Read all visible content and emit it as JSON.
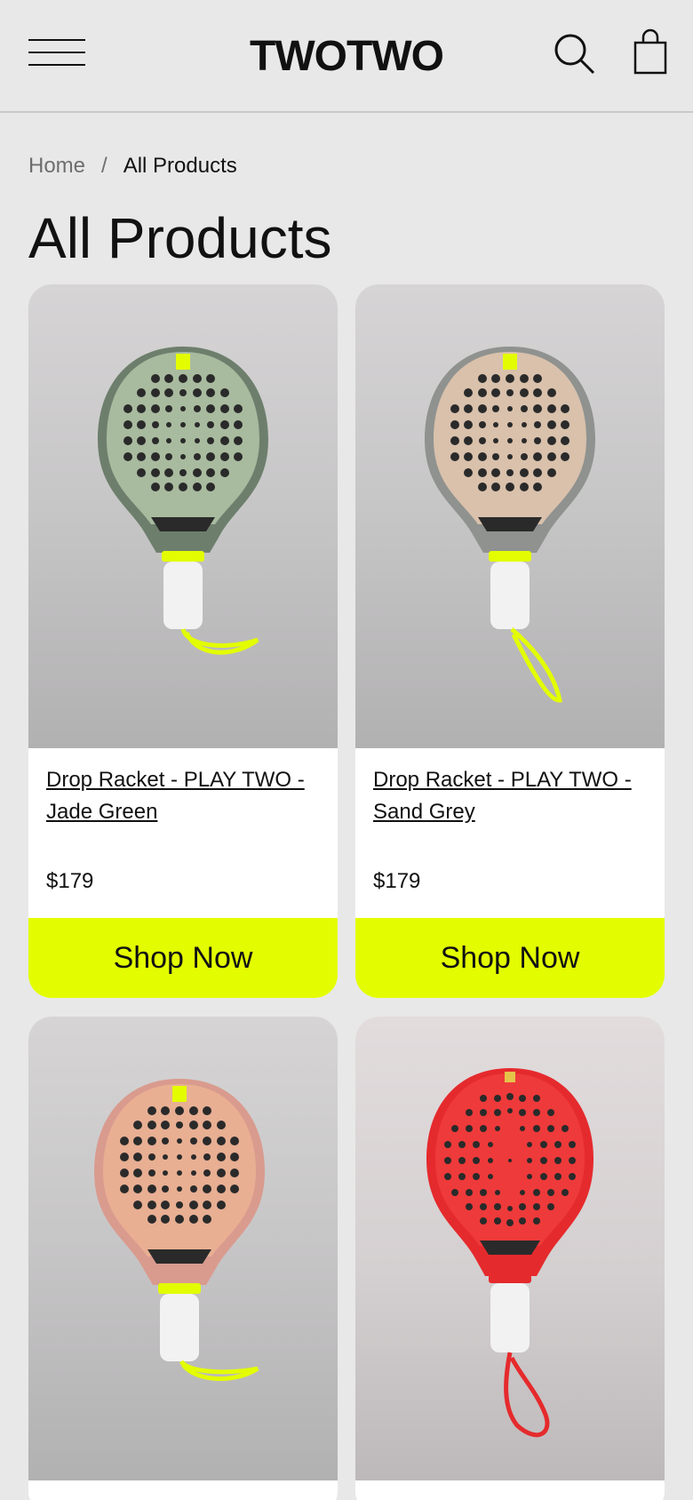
{
  "header": {
    "logo": "TWOTWO",
    "menu_icon": "hamburger-menu-icon",
    "search_icon": "search-icon",
    "bag_icon": "shopping-bag-icon"
  },
  "breadcrumb": {
    "home": "Home",
    "separator": "/",
    "current": "All Products"
  },
  "page_title": "All Products",
  "products": [
    {
      "name": "Drop Racket - PLAY TWO - Jade Green",
      "price": "$179",
      "cta": "Shop Now",
      "face_color": "#a9bb9f",
      "frame_color": "#6d7f6c",
      "strap_color": "#e3fd00"
    },
    {
      "name": "Drop Racket - PLAY TWO - Sand Grey",
      "price": "$179",
      "cta": "Shop Now",
      "face_color": "#d9c1ac",
      "frame_color": "#8f928f",
      "strap_color": "#e3fd00"
    },
    {
      "name": "",
      "price": "",
      "cta": "",
      "face_color": "#e8af93",
      "frame_color": "#d99b8e",
      "strap_color": "#e3fd00"
    },
    {
      "name": "",
      "price": "",
      "cta": "",
      "face_color": "#ee3a3a",
      "frame_color": "#e52a2d",
      "strap_color": "#e52a2d"
    }
  ],
  "colors": {
    "background": "#e8e8e8",
    "accent": "#e3fd00",
    "text": "#111111"
  }
}
